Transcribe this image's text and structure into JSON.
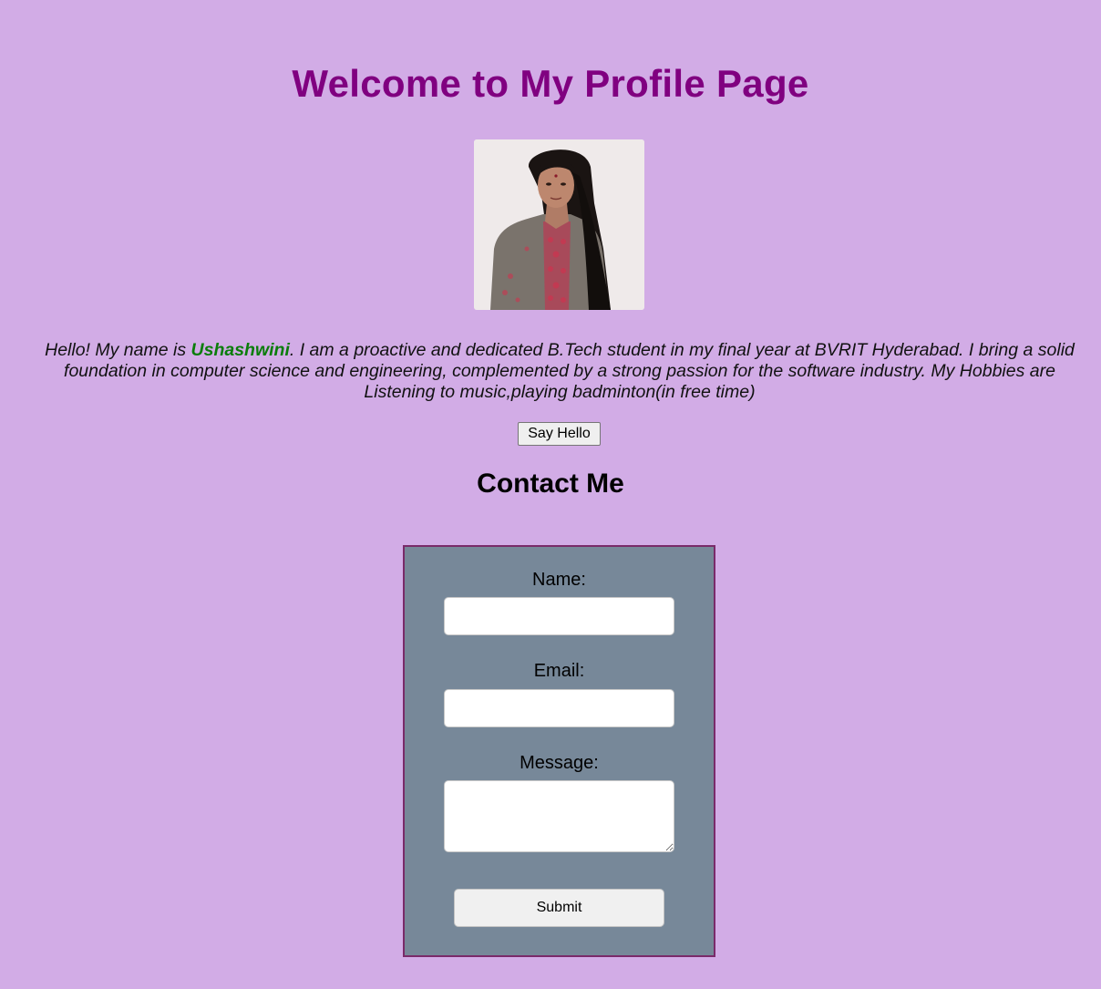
{
  "header": {
    "title": "Welcome to My Profile Page"
  },
  "profile": {
    "bio_prefix": "Hello! My name is ",
    "name": "Ushashwini",
    "bio_suffix": ". I am a proactive and dedicated B.Tech student in my final year at BVRIT Hyderabad. I bring a solid foundation in computer science and engineering, complemented by a strong passion for the software industry. My Hobbies are Listening to music,playing badminton(in free time)",
    "hello_button_label": "Say Hello"
  },
  "contact": {
    "title": "Contact Me",
    "name_label": "Name:",
    "name_value": "",
    "email_label": "Email:",
    "email_value": "",
    "message_label": "Message:",
    "message_value": "",
    "submit_label": "Submit"
  },
  "colors": {
    "page_background": "#d2ace6",
    "title": "#800080",
    "name_highlight": "#0a7d0a",
    "form_background": "#778899",
    "form_border": "#7a2a6a"
  }
}
